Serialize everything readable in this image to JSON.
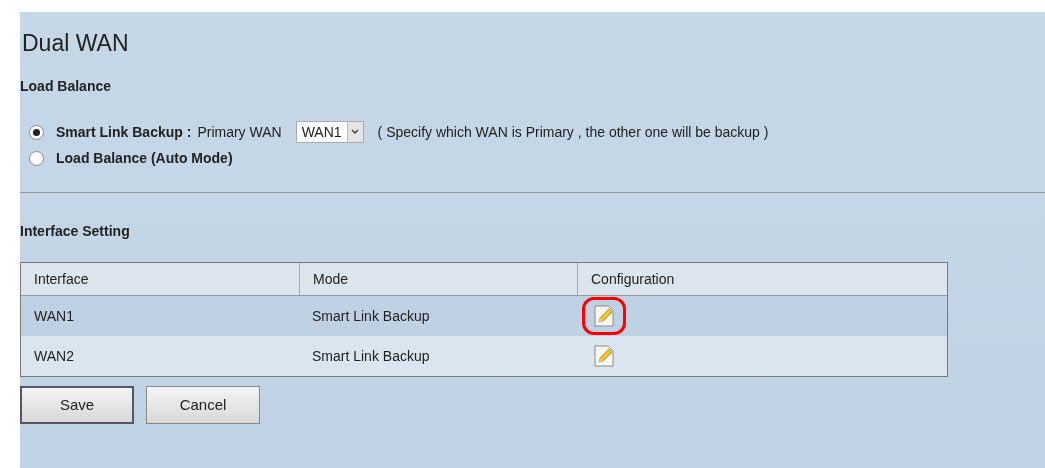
{
  "page_title": "Dual WAN",
  "load_balance": {
    "heading": "Load Balance",
    "options": [
      {
        "kind": "select",
        "label": "Smart Link Backup :",
        "selected": true,
        "field_label": "Primary WAN",
        "value": "WAN1",
        "hint": "( Specify which WAN is Primary , the other one will be backup )"
      },
      {
        "kind": "plain",
        "label": "Load Balance (Auto Mode)",
        "selected": false
      }
    ]
  },
  "interface_setting": {
    "heading": "Interface Setting",
    "columns": [
      "Interface",
      "Mode",
      "Configuration"
    ],
    "rows": [
      {
        "interface": "WAN1",
        "mode": "Smart Link Backup",
        "highlighted": true
      },
      {
        "interface": "WAN2",
        "mode": "Smart Link Backup",
        "highlighted": false
      }
    ]
  },
  "buttons": [
    "Save",
    "Cancel"
  ]
}
